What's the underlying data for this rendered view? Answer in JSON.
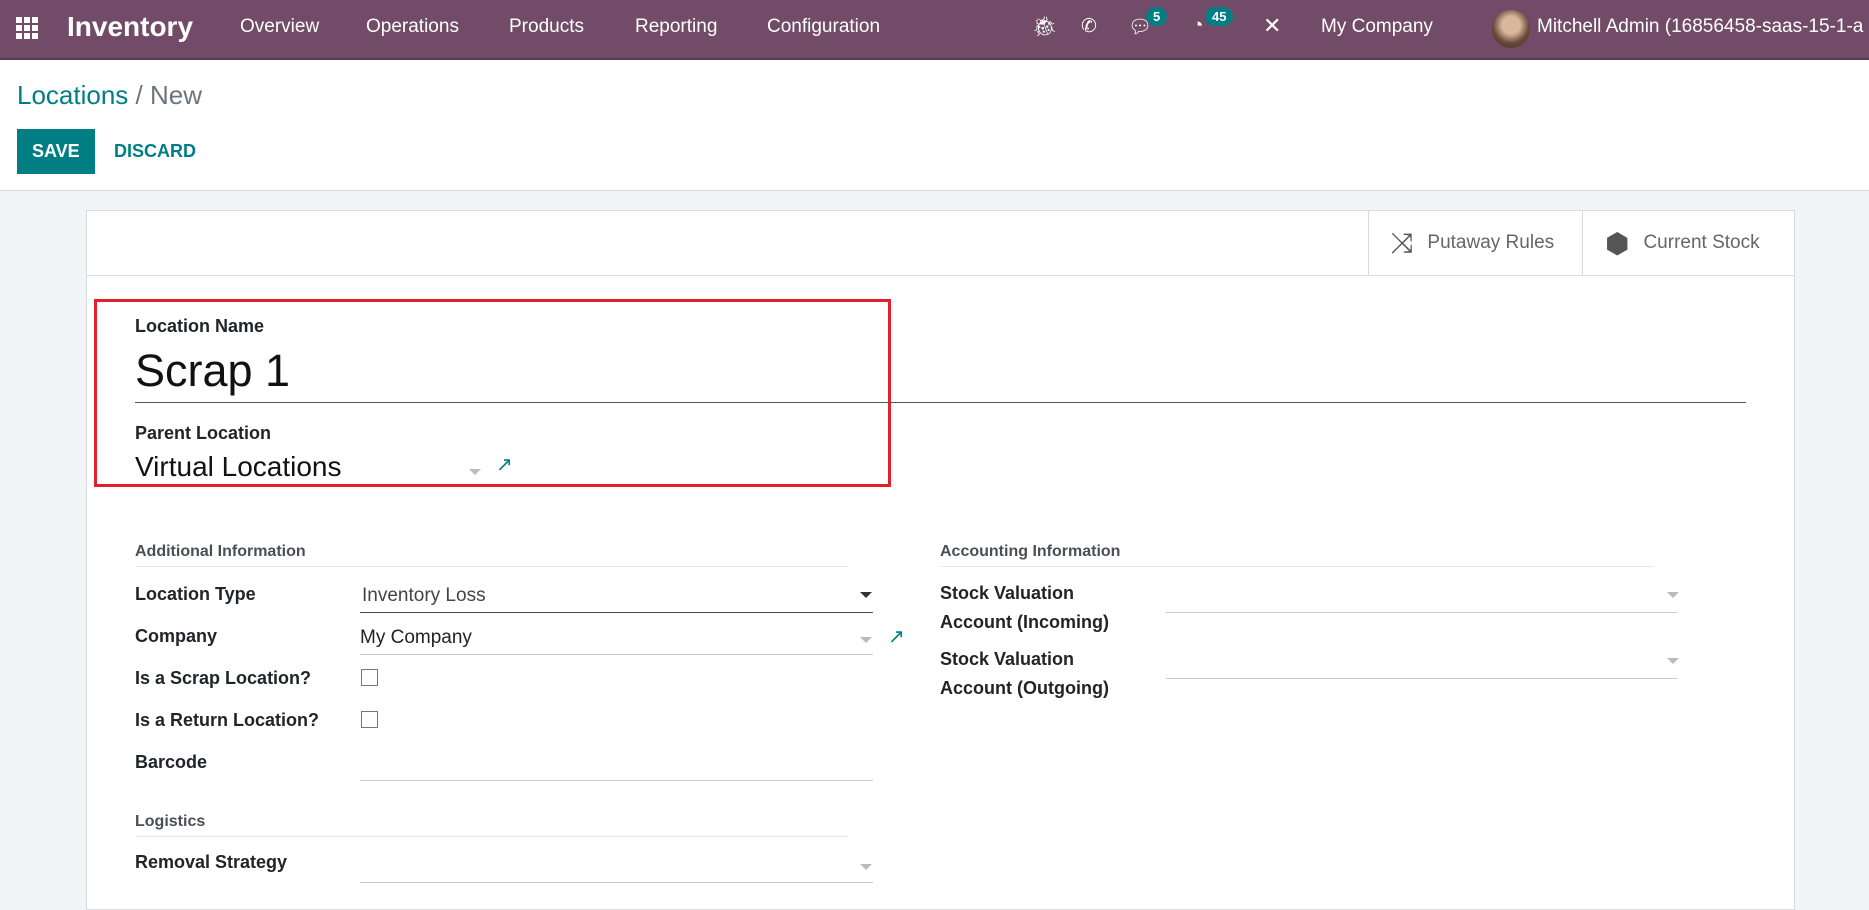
{
  "navbar": {
    "app_name": "Inventory",
    "menu": [
      "Overview",
      "Operations",
      "Products",
      "Reporting",
      "Configuration"
    ],
    "messages_count": "5",
    "activities_count": "45",
    "company": "My Company",
    "user": "Mitchell Admin (16856458-saas-15-1-a"
  },
  "breadcrumb": {
    "parent": "Locations",
    "current": "/ New"
  },
  "actions": {
    "save": "SAVE",
    "discard": "DISCARD"
  },
  "smart_buttons": {
    "putaway": "Putaway Rules",
    "stock": "Current Stock"
  },
  "form": {
    "location_name_label": "Location Name",
    "location_name": "Scrap 1",
    "parent_label": "Parent Location",
    "parent_value": "Virtual Locations",
    "additional": {
      "title": "Additional Information",
      "location_type_label": "Location Type",
      "location_type": "Inventory Loss",
      "company_label": "Company",
      "company": "My Company",
      "scrap_label": "Is a Scrap Location?",
      "scrap_checked": false,
      "return_label": "Is a Return Location?",
      "return_checked": false,
      "barcode_label": "Barcode",
      "barcode": ""
    },
    "logistics": {
      "title": "Logistics",
      "removal_label": "Removal Strategy",
      "removal": ""
    },
    "accounting": {
      "title": "Accounting Information",
      "incoming_label_1": "Stock Valuation",
      "incoming_label_2": "Account (Incoming)",
      "outgoing_label_1": "Stock Valuation",
      "outgoing_label_2": "Account (Outgoing)"
    }
  },
  "colors": {
    "navbar": "#714b67",
    "primary": "#017e84",
    "highlight": "#e3202b"
  }
}
